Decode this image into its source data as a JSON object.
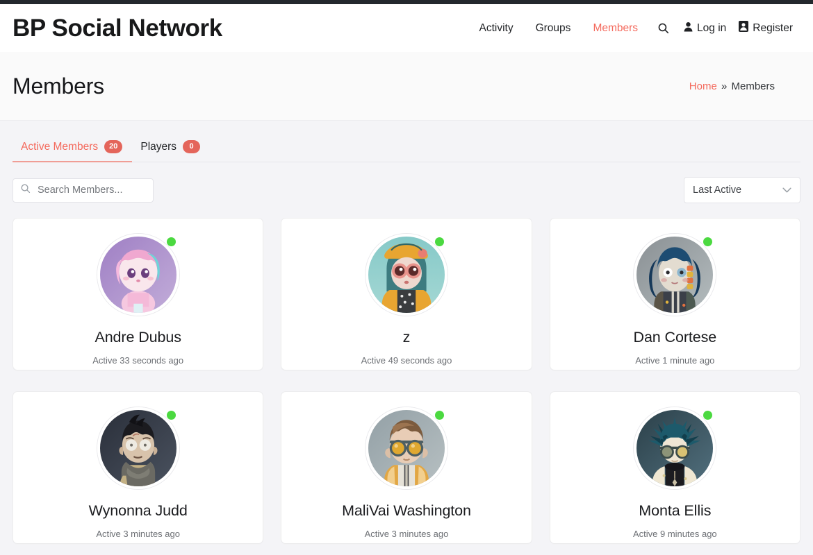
{
  "admin_bar": {
    "present": true,
    "color": "#23282d"
  },
  "header": {
    "site_title": "BP Social Network",
    "nav": [
      {
        "label": "Activity",
        "active": false
      },
      {
        "label": "Groups",
        "active": false
      },
      {
        "label": "Members",
        "active": true
      }
    ],
    "search_icon": "search-icon",
    "login": {
      "label": "Log in",
      "icon": "user-icon"
    },
    "register": {
      "label": "Register",
      "icon": "register-card-icon"
    }
  },
  "page": {
    "title": "Members",
    "breadcrumb": {
      "home": "Home",
      "separator": "»",
      "current": "Members"
    }
  },
  "tabs": [
    {
      "label": "Active Members",
      "count": "20",
      "active": true
    },
    {
      "label": "Players",
      "count": "0",
      "active": false
    }
  ],
  "search": {
    "placeholder": "Search Members...",
    "value": "",
    "icon": "search-icon"
  },
  "sort": {
    "selected": "Last Active",
    "icon": "chevron-down-icon"
  },
  "members": [
    {
      "name": "Andre Dubus",
      "activity": "Active 33 seconds ago",
      "online": true,
      "avatar": {
        "bg_from": "#9f7fc4",
        "bg_to": "#b7a0d6",
        "hair": "#f0a8d0",
        "hair2": "#6fd4d8",
        "skin": "#f7e2e8",
        "outfit": "#f4b9d8"
      }
    },
    {
      "name": "z",
      "activity": "Active 49 seconds ago",
      "online": true,
      "avatar": {
        "bg_from": "#79c3c4",
        "bg_to": "#8fd0cf",
        "hair": "#3d7c80",
        "hair2": "#2f6669",
        "skin": "#efd8cf",
        "outfit": "#e8a531"
      }
    },
    {
      "name": "Dan Cortese",
      "activity": "Active 1 minute ago",
      "online": true,
      "avatar": {
        "bg_from": "#8a9094",
        "bg_to": "#a9b0b3",
        "hair": "#1d4c72",
        "hair2": "#16395a",
        "skin": "#e3dcd0",
        "outfit": "#3b4049"
      }
    },
    {
      "name": "Wynonna Judd",
      "activity": "Active 3 minutes ago",
      "online": true,
      "avatar": {
        "bg_from": "#2e3440",
        "bg_to": "#434b57",
        "hair": "#1b1b1f",
        "hair2": "#111115",
        "skin": "#d8c3ab",
        "outfit": "#c4b184"
      }
    },
    {
      "name": "MaliVai Washington",
      "activity": "Active 3 minutes ago",
      "online": true,
      "avatar": {
        "bg_from": "#9aa5aa",
        "bg_to": "#b3bdc0",
        "hair": "#7c5b3d",
        "hair2": "#5e432b",
        "skin": "#e8cdb6",
        "outfit": "#e2a744"
      }
    },
    {
      "name": "Monta Ellis",
      "activity": "Active 9 minutes ago",
      "online": true,
      "avatar": {
        "bg_from": "#2f4550",
        "bg_to": "#4c6370",
        "hair": "#1d5a6b",
        "hair2": "#123f4d",
        "skin": "#efe6d4",
        "outfit": "#1c1c20"
      }
    }
  ],
  "colors": {
    "accent": "#f4695c",
    "badge": "#e4655b",
    "online": "#4bd940",
    "page_bg": "#f4f4f7",
    "card_bg": "#ffffff"
  }
}
